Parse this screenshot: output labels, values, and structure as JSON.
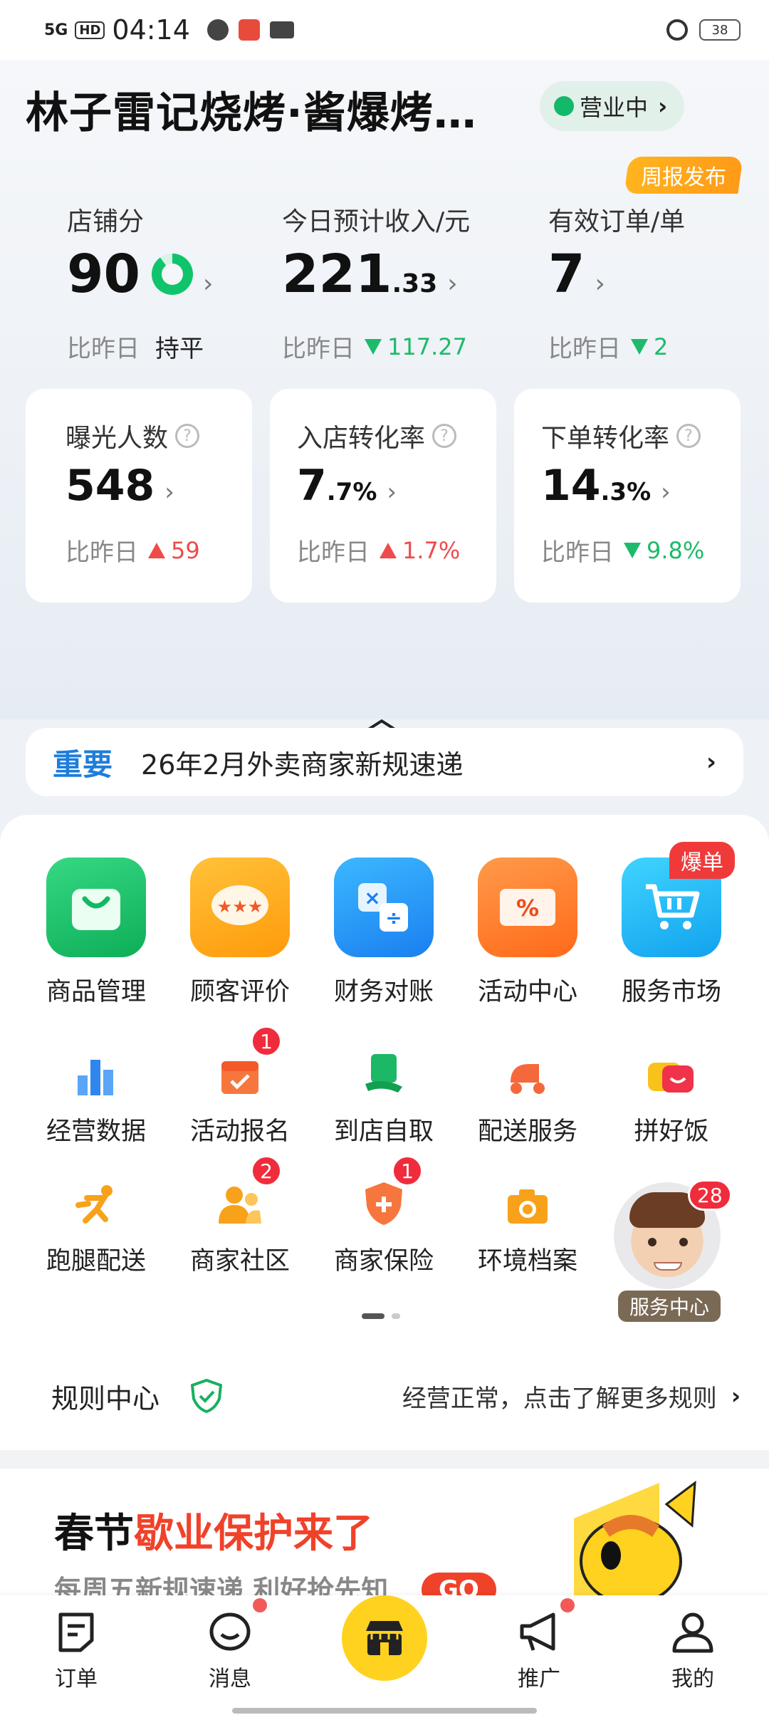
{
  "status_bar": {
    "network": "5G",
    "hd": "HD",
    "time": "04:14",
    "battery": "38"
  },
  "header": {
    "store_name": "林子雷记烧烤·酱爆烤…",
    "status": "营业中",
    "weekly_badge": "周报发布"
  },
  "metrics": [
    {
      "label": "店铺分",
      "value": "90",
      "decimal": "",
      "compare_label": "比昨日",
      "compare_value": "持平",
      "trend": "flat",
      "score_fraction": 0.9
    },
    {
      "label": "今日预计收入/元",
      "value": "221",
      "decimal": ".33",
      "compare_label": "比昨日",
      "compare_value": "117.27",
      "trend": "down"
    },
    {
      "label": "有效订单/单",
      "value": "7",
      "decimal": "",
      "compare_label": "比昨日",
      "compare_value": "2",
      "trend": "down"
    }
  ],
  "cards": [
    {
      "label": "曝光人数",
      "value": "548",
      "decimal": "",
      "compare_label": "比昨日",
      "compare_value": "59",
      "trend": "up"
    },
    {
      "label": "入店转化率",
      "value": "7",
      "decimal": ".7%",
      "compare_label": "比昨日",
      "compare_value": "1.7%",
      "trend": "up"
    },
    {
      "label": "下单转化率",
      "value": "14",
      "decimal": ".3%",
      "compare_label": "比昨日",
      "compare_value": "9.8%",
      "trend": "down"
    }
  ],
  "notice": {
    "tag": "重要",
    "text": "26年2月外卖商家新规速递"
  },
  "main_tools": [
    {
      "label": "商品管理",
      "icon": "shopping-bag-icon",
      "color": "#14c56a"
    },
    {
      "label": "顾客评价",
      "icon": "review-stars-icon",
      "color": "#ffa516"
    },
    {
      "label": "财务对账",
      "icon": "calculator-icon",
      "color": "#1c9cf5"
    },
    {
      "label": "活动中心",
      "icon": "coupon-icon",
      "color": "#ff7a1e"
    },
    {
      "label": "服务市场",
      "icon": "cart-icon",
      "color": "#1ab4f0",
      "badge": "爆单"
    }
  ],
  "sub_tools_row1": [
    {
      "label": "经营数据",
      "icon": "bar-chart-icon",
      "color": "#3d8ef0"
    },
    {
      "label": "活动报名",
      "icon": "calendar-check-icon",
      "color": "#f56a3c",
      "badge": "1"
    },
    {
      "label": "到店自取",
      "icon": "pickup-bag-icon",
      "color": "#18b060"
    },
    {
      "label": "配送服务",
      "icon": "scooter-icon",
      "color": "#f5683c"
    },
    {
      "label": "拼好饭",
      "icon": "bowl-icon",
      "color": "#f7c21a"
    }
  ],
  "sub_tools_row2": [
    {
      "label": "跑腿配送",
      "icon": "runner-icon",
      "color": "#f7a21a"
    },
    {
      "label": "商家社区",
      "icon": "community-icon",
      "color": "#f59a1a",
      "badge": "2"
    },
    {
      "label": "商家保险",
      "icon": "shield-plus-icon",
      "color": "#f5683c",
      "badge": "1"
    },
    {
      "label": "环境档案",
      "icon": "camera-icon",
      "color": "#f7a21a"
    }
  ],
  "assistant": {
    "label": "服务中心",
    "badge": "28"
  },
  "rules": {
    "title": "规则中心",
    "message": "经营正常，点击了解更多规则"
  },
  "banner": {
    "title_black": "春节",
    "title_red": "歇业保护来了",
    "subtitle": "每周五新规速递 利好抢先知",
    "cta": "GO"
  },
  "bottom_nav": [
    {
      "label": "订单",
      "icon": "order-icon"
    },
    {
      "label": "消息",
      "icon": "message-icon",
      "dot": true
    },
    {
      "label": "",
      "icon": "store-icon"
    },
    {
      "label": "推广",
      "icon": "megaphone-icon",
      "dot": true
    },
    {
      "label": "我的",
      "icon": "profile-icon"
    }
  ]
}
